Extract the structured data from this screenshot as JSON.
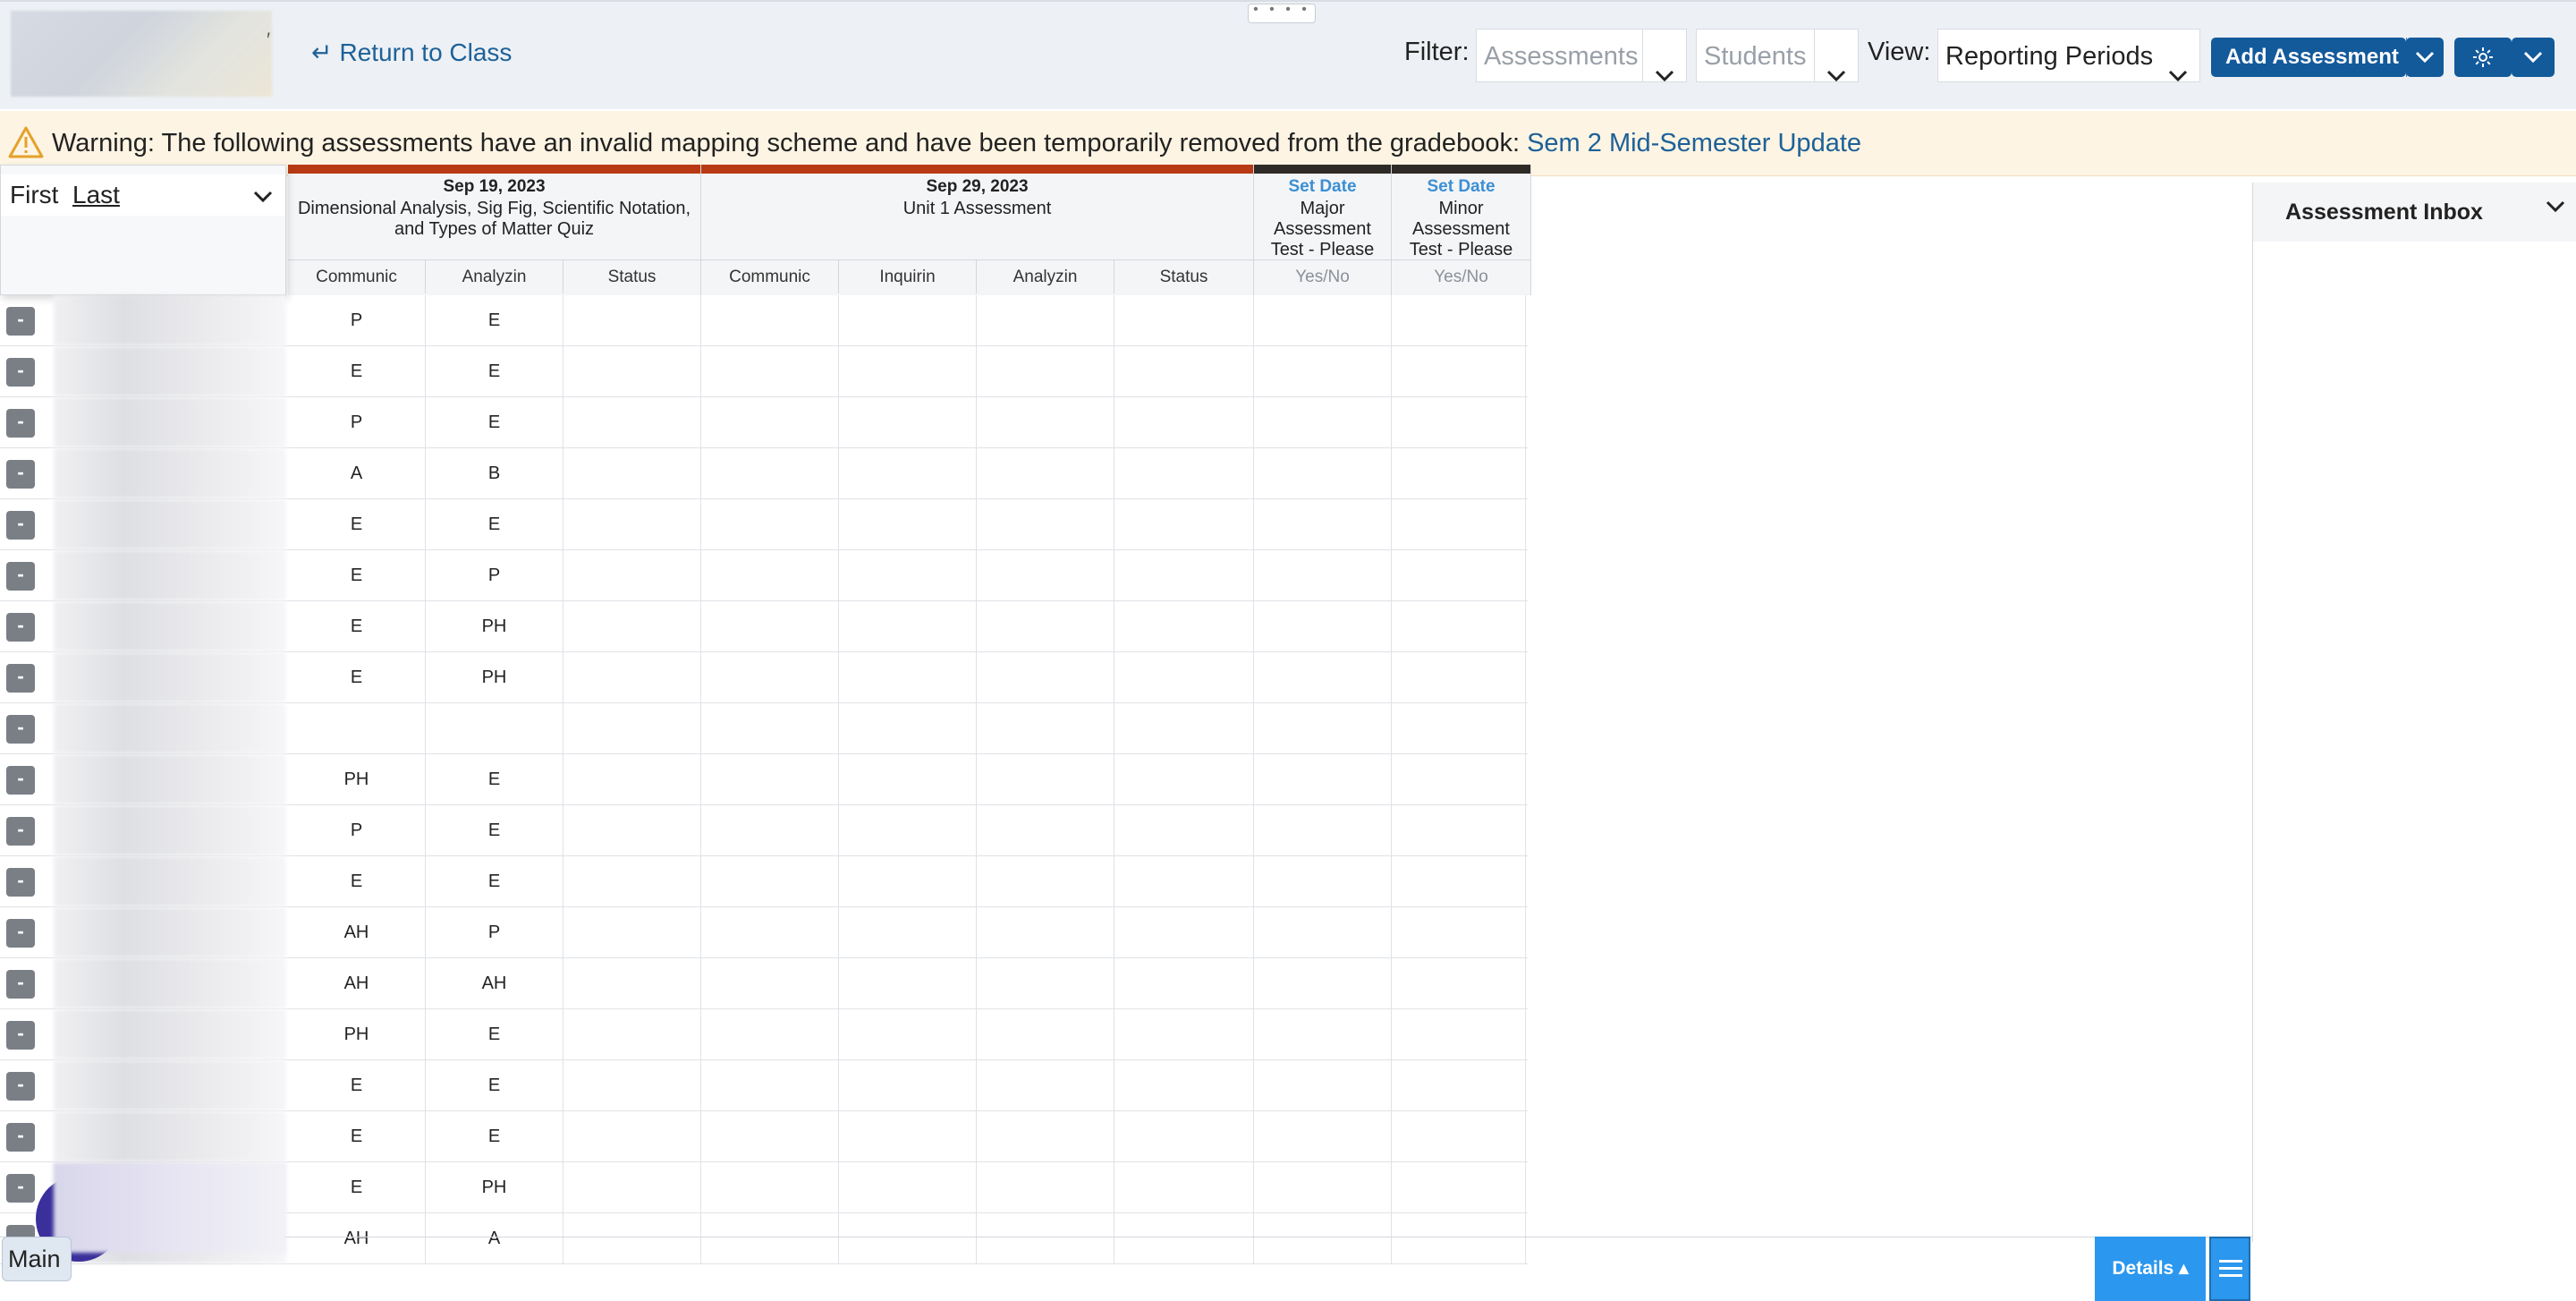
{
  "toolbar": {
    "return_label": "Return to Class",
    "filter_label": "Filter:",
    "assessments_placeholder": "Assessments",
    "students_placeholder": "Students",
    "view_label": "View:",
    "view_value": "Reporting Periods",
    "add_assessment_label": "Add Assessment"
  },
  "warning": {
    "message": "Warning: The following assessments have an invalid mapping scheme and have been temporarily removed from the gradebook:",
    "link": "Sem 2 Mid-Semester Update"
  },
  "sort": {
    "first": "First",
    "last": "Last"
  },
  "assessments": [
    {
      "date": "Sep 19, 2023",
      "title": "Dimensional Analysis, Sig Fig, Scientific Notation, and Types of Matter Quiz",
      "color": "#b83a14"
    },
    {
      "date": "Sep 29, 2023",
      "title": "Unit 1 Assessment",
      "color": "#b83a14"
    },
    {
      "date": "Set Date",
      "title": "Major Assessment Test - Please",
      "color": "#2e2a26"
    },
    {
      "date": "Set Date",
      "title": "Minor Assessment Test - Please",
      "color": "#2e2a26"
    }
  ],
  "columns": [
    "Communic",
    "Analyzin",
    "Status",
    "Communic",
    "Inquirin",
    "Analyzin",
    "Status",
    "Yes/No",
    "Yes/No"
  ],
  "row_button": "-",
  "rows": [
    [
      "P",
      "E"
    ],
    [
      "E",
      "E"
    ],
    [
      "P",
      "E"
    ],
    [
      "A",
      "B"
    ],
    [
      "E",
      "E"
    ],
    [
      "E",
      "P"
    ],
    [
      "E",
      "PH"
    ],
    [
      "E",
      "PH"
    ],
    [
      "",
      ""
    ],
    [
      "PH",
      "E"
    ],
    [
      "P",
      "E"
    ],
    [
      "E",
      "E"
    ],
    [
      "AH",
      "P"
    ],
    [
      "AH",
      "AH"
    ],
    [
      "PH",
      "E"
    ],
    [
      "E",
      "E"
    ],
    [
      "E",
      "E"
    ],
    [
      "E",
      "PH"
    ],
    [
      "AH",
      "A"
    ]
  ],
  "inbox": {
    "title": "Assessment Inbox"
  },
  "bottom": {
    "main_tab": "Main",
    "details_label": "Details ▴"
  },
  "colors": {
    "primary": "#135a9b",
    "accent": "#2b97ee",
    "warning_bg": "#fdf4e3",
    "link": "#1d6198"
  }
}
